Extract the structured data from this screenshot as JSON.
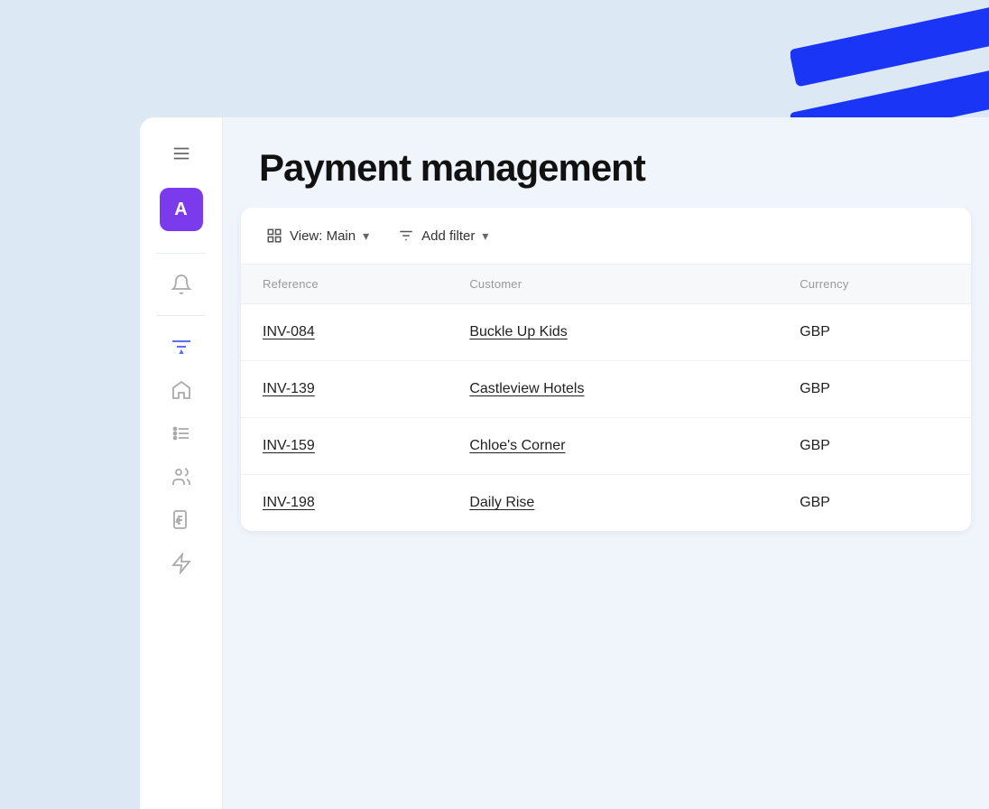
{
  "page": {
    "title": "Payment management"
  },
  "sidebar": {
    "avatar_label": "A",
    "items": [
      {
        "name": "menu",
        "icon": "menu"
      },
      {
        "name": "avatar",
        "label": "A"
      },
      {
        "name": "notifications",
        "icon": "bell"
      },
      {
        "name": "filter",
        "icon": "filter",
        "active": true
      },
      {
        "name": "home",
        "icon": "home"
      },
      {
        "name": "tasks",
        "icon": "tasks"
      },
      {
        "name": "users",
        "icon": "users"
      },
      {
        "name": "invoices",
        "icon": "file-invoice"
      },
      {
        "name": "bolt",
        "icon": "bolt"
      }
    ]
  },
  "toolbar": {
    "view_label": "View: Main",
    "filter_label": "Add filter",
    "view_icon": "table-icon",
    "filter_icon": "filter-icon",
    "chevron": "▾"
  },
  "table": {
    "columns": [
      {
        "key": "reference",
        "label": "Reference"
      },
      {
        "key": "customer",
        "label": "Customer"
      },
      {
        "key": "currency",
        "label": "Currency"
      }
    ],
    "rows": [
      {
        "reference": "INV-084",
        "customer": "Buckle Up Kids",
        "currency": "GBP"
      },
      {
        "reference": "INV-139",
        "customer": "Castleview Hotels",
        "currency": "GBP"
      },
      {
        "reference": "INV-159",
        "customer": "Chloe's Corner",
        "currency": "GBP"
      },
      {
        "reference": "INV-198",
        "customer": "Daily Rise",
        "currency": "GBP"
      }
    ]
  }
}
